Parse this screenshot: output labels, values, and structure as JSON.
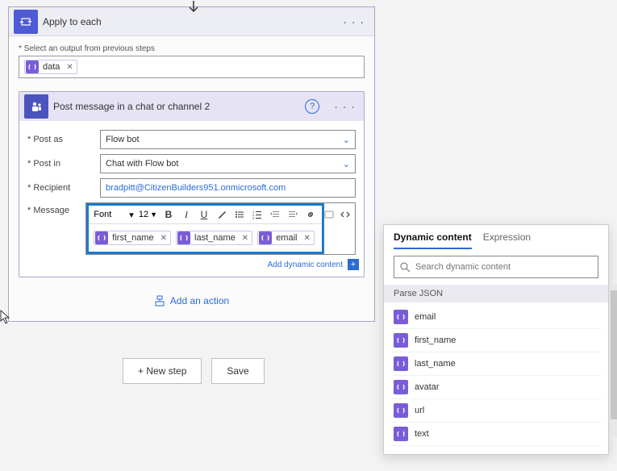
{
  "outer": {
    "title": "Apply to each",
    "select_label": "* Select an output from previous steps",
    "data_pill": "data"
  },
  "inner": {
    "title": "Post message in a chat or channel 2",
    "fields": {
      "post_as": {
        "label": "* Post as",
        "value": "Flow bot"
      },
      "post_in": {
        "label": "* Post in",
        "value": "Chat with Flow bot"
      },
      "recipient": {
        "label": "* Recipient",
        "value": "bradpitt@CitizenBuilders951.onmicrosoft.com"
      },
      "message": {
        "label": "* Message"
      }
    },
    "message_pills": [
      "first_name",
      "last_name",
      "email"
    ],
    "toolbar": {
      "font": "Font",
      "size": "12"
    },
    "add_dynamic": "Add dynamic content",
    "add_action": "Add an action"
  },
  "controls": {
    "new_step": "+ New step",
    "save": "Save"
  },
  "panel": {
    "tab_dynamic": "Dynamic content",
    "tab_expression": "Expression",
    "search_placeholder": "Search dynamic content",
    "section": "Parse JSON",
    "items": [
      "email",
      "first_name",
      "last_name",
      "avatar",
      "url",
      "text"
    ]
  }
}
